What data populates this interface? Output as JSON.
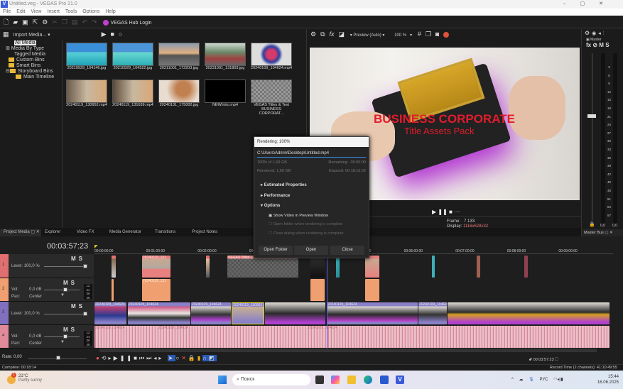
{
  "window": {
    "title": "Untitled.veg - VEGAS Pro 21.0",
    "app_icon": "V"
  },
  "menu": [
    "File",
    "Edit",
    "View",
    "Insert",
    "Tools",
    "Options",
    "Help"
  ],
  "toolbar": {
    "hub_login": "VEGAS Hub Login"
  },
  "media": {
    "import_label": "Import Media...",
    "tree": [
      "All Media",
      "Media By Type",
      "Tagged Media",
      "Custom Bins",
      "Smart Bins",
      "Storyboard Bins",
      "Main Timeline"
    ],
    "items": [
      "20210929_104146.jpg",
      "20210929_104522.jpg",
      "20211001_172203.jpg",
      "20231001_131803.jpg",
      "20240109_104624.mp4",
      "20240119_130952.mp4",
      "20240119_131639.mp4",
      "20240131_175002.jpg",
      "NEWIntro.mp4",
      "VEGAS Titles & Text BUSINESS CORPORAT..."
    ]
  },
  "preview": {
    "mode": "Preview (Auto)",
    "zoom": "100 %",
    "title_main": "BUSINESS CORPORATE",
    "title_sub": "Title Assets Pack",
    "frame_label": "Frame:",
    "frame": "7 133",
    "display_label": "Display:",
    "display": "1116x628x32"
  },
  "master": {
    "label": "Master",
    "fx": "fx",
    "m": "M",
    "s": "S",
    "scale": [
      "3",
      "6",
      "9",
      "12",
      "15",
      "18",
      "21",
      "24",
      "27",
      "30",
      "33",
      "36",
      "39",
      "42",
      "45",
      "48",
      "51",
      "54",
      "57"
    ],
    "left_val": "0,0",
    "right_val": "0,0",
    "bus_label": "Master Bus"
  },
  "tabs": [
    "Project Media",
    "Explorer",
    "Video FX",
    "Media Generator",
    "Transitions",
    "Project Notes"
  ],
  "timeline": {
    "timecode": "00:03:57:23",
    "ruler": [
      "00:00:00:00",
      "00:01:00:00",
      "00:02:00:00",
      "00:03:00:00",
      "00:04:00:00",
      "00:05:00:00",
      "00:06:00:00",
      "00:07:00:00",
      "00:08:00:00",
      "00:09:00:00"
    ],
    "tracks": [
      {
        "num": "1",
        "m": "M",
        "s": "S",
        "level_label": "Level:",
        "level": "100,0 %",
        "level_pct": 100
      },
      {
        "num": "2",
        "m": "M",
        "s": "S",
        "vol_label": "Vol:",
        "vol": "0,0 dB",
        "pan_label": "Pan:",
        "pan": "Center"
      },
      {
        "num": "3",
        "m": "M",
        "s": "S",
        "level_label": "Level:",
        "level": "100,0 %",
        "level_pct": 100
      },
      {
        "num": "4",
        "m": "M",
        "s": "S",
        "vol_label": "Vol:",
        "vol": "0,0 dB",
        "pan_label": "Pan:",
        "pan": "Center"
      }
    ],
    "meter_scale": [
      "12",
      "24",
      "36",
      "48"
    ],
    "clips": {
      "c1": "20240119_131",
      "c2": "VEGAS Titles & Text",
      "c3": "20240119_131",
      "c4": "20240109_104624",
      "c5": "20240109_104624",
      "c6": "20240119_130952",
      "c7": "20240109_104624",
      "c8": "20240109_104624",
      "c9": "20240109_104624",
      "c10": "20240109_104624",
      "c11": "20240109_104624",
      "c12": "20240109_104624"
    },
    "rate_label": "Rate:",
    "rate": "0,00",
    "cursor_time": "00:03:57:23"
  },
  "status": {
    "complete": "Complete: 00:18:14",
    "record_time": "Record Time (2 channels): 41:10:49:55"
  },
  "render": {
    "title": "Rendering: 100%",
    "path": "C:\\Users\\Admin\\Desktop\\Untitled.mp4",
    "progress_pct": 100,
    "size": "100% of 1,69 GB",
    "remaining": "Remaining: -00:00:00",
    "rendered": "Rendered: 1,69 GB",
    "elapsed": "Elapsed: 00:18:15.62",
    "sections": [
      "Estimated Properties",
      "Performance",
      "Options"
    ],
    "options": [
      {
        "label": "Show Video in Preview Window",
        "checked": true
      },
      {
        "label": "Open folder when rendering is complete",
        "checked": false
      },
      {
        "label": "Close dialog when rendering is complete",
        "checked": false
      }
    ],
    "buttons": [
      "Open Folder",
      "Open",
      "Close"
    ]
  },
  "taskbar": {
    "temp": "21°C",
    "weather": "Partly sunny",
    "badge": "1",
    "search": "Поиск",
    "lang": "РУС",
    "time": "15:44",
    "date": "16.06.2025"
  }
}
